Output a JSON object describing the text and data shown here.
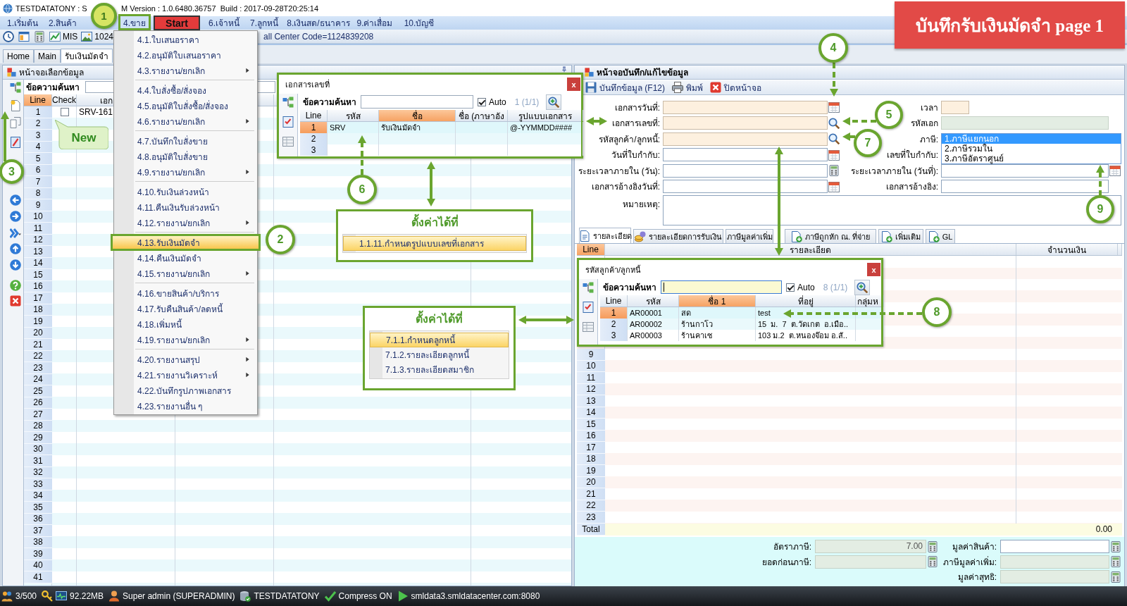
{
  "window": {
    "title_parts": [
      "TESTDATATONY : S",
      "M Version : 1.0.6480.36757  Build : 2017-09-28T20:25:14"
    ]
  },
  "menu_bar": [
    {
      "label": "1.เริ่มต้น",
      "selected": false
    },
    {
      "label": "2.สินค้า",
      "selected": false
    },
    {
      "label": "4.ขาย",
      "selected": true
    },
    {
      "label": "6.เจ้าหนี้",
      "selected": false
    },
    {
      "label": "7.ลูกหนี้",
      "selected": false
    },
    {
      "label": "8.เงินสด/ธนาคาร",
      "selected": false
    },
    {
      "label": "9.ค่าเสื่อม",
      "selected": false
    },
    {
      "label": "10.บัญชี",
      "selected": false
    }
  ],
  "start_badge": {
    "label": "Start"
  },
  "toolbar": {
    "items": [
      {
        "label": "MIS",
        "kind": "chart"
      },
      {
        "label": "1024",
        "kind": "picture"
      }
    ],
    "info": "all Center Code=1124839208"
  },
  "tabs": [
    {
      "label": "Home",
      "selected": false
    },
    {
      "label": "Main",
      "selected": false
    },
    {
      "label": "รับเงินมัดจำ",
      "selected": true
    }
  ],
  "sales_menu": {
    "sections": [
      {
        "items": [
          {
            "label": "4.1.ใบเสนอราคา",
            "submenu": false,
            "selected": false
          },
          {
            "label": "4.2.อนุมัติใบเสนอราคา",
            "submenu": false,
            "selected": false
          },
          {
            "label": "4.3.รายงาน/ยกเลิก",
            "submenu": true,
            "selected": false
          }
        ]
      },
      {
        "items": [
          {
            "label": "4.4.ใบสั่งซื้อ/สั่งจอง",
            "submenu": false,
            "selected": false
          },
          {
            "label": "4.5.อนุมัติใบสั่งซื้อ/สั่งจอง",
            "submenu": false,
            "selected": false
          },
          {
            "label": "4.6.รายงาน/ยกเลิก",
            "submenu": true,
            "selected": false
          }
        ]
      },
      {
        "items": [
          {
            "label": "4.7.บันทึกใบสั่งขาย",
            "submenu": false,
            "selected": false
          },
          {
            "label": "4.8.อนุมัติใบสั่งขาย",
            "submenu": false,
            "selected": false
          },
          {
            "label": "4.9.รายงาน/ยกเลิก",
            "submenu": true,
            "selected": false
          }
        ]
      },
      {
        "items": [
          {
            "label": "4.10.รับเงินล่วงหน้า",
            "submenu": false,
            "selected": false
          },
          {
            "label": "4.11.คืนเงินรับล่วงหน้า",
            "submenu": false,
            "selected": false
          },
          {
            "label": "4.12.รายงาน/ยกเลิก",
            "submenu": true,
            "selected": false
          }
        ]
      },
      {
        "items": [
          {
            "label": "4.13.รับเงินมัดจำ",
            "submenu": false,
            "selected": true
          },
          {
            "label": "4.14.คืนเงินมัดจำ",
            "submenu": false,
            "selected": false
          },
          {
            "label": "4.15.รายงาน/ยกเลิก",
            "submenu": true,
            "selected": false
          }
        ]
      },
      {
        "items": [
          {
            "label": "4.16.ขายสินค้า/บริการ",
            "submenu": false,
            "selected": false
          },
          {
            "label": "4.17.รับคืนสินค้า/ลดหนี้",
            "submenu": false,
            "selected": false
          },
          {
            "label": "4.18.เพิ่มหนี้",
            "submenu": false,
            "selected": false
          },
          {
            "label": "4.19.รายงาน/ยกเลิก",
            "submenu": true,
            "selected": false
          }
        ]
      },
      {
        "items": [
          {
            "label": "4.20.รายงานสรุป",
            "submenu": true,
            "selected": false
          },
          {
            "label": "4.21.รายงานวิเคราะห์",
            "submenu": true,
            "selected": false
          },
          {
            "label": "4.22.บันทึกรูปภาพเอกสาร",
            "submenu": false,
            "selected": false
          },
          {
            "label": "4.23.รายงานอื่น ๆ",
            "submenu": false,
            "selected": false
          }
        ]
      }
    ]
  },
  "selection_panel": {
    "title": "หน้าจอเลือกข้อมูล",
    "search_label": "ข้อความค้นหา",
    "columns": [
      {
        "label": "Line",
        "sorted": true
      },
      {
        "label": "Check",
        "sorted": false
      },
      {
        "label": "เอก",
        "sorted": false
      }
    ],
    "rows": [
      {
        "line": "1",
        "checked": false,
        "document": "SRV-161"
      },
      {
        "line": "2"
      },
      {
        "line": "3"
      },
      {
        "line": "4"
      },
      {
        "line": "5"
      },
      {
        "line": "6"
      },
      {
        "line": "7"
      },
      {
        "line": "8"
      },
      {
        "line": "9"
      },
      {
        "line": "10"
      },
      {
        "line": "11"
      },
      {
        "line": "12"
      },
      {
        "line": "13"
      },
      {
        "line": "14"
      },
      {
        "line": "15"
      },
      {
        "line": "16"
      },
      {
        "line": "17"
      },
      {
        "line": "18"
      },
      {
        "line": "19"
      },
      {
        "line": "20"
      },
      {
        "line": "21"
      },
      {
        "line": "22"
      },
      {
        "line": "23"
      },
      {
        "line": "24"
      },
      {
        "line": "25"
      },
      {
        "line": "26"
      },
      {
        "line": "27"
      },
      {
        "line": "28"
      },
      {
        "line": "29"
      },
      {
        "line": "30"
      },
      {
        "line": "31"
      },
      {
        "line": "32"
      },
      {
        "line": "33"
      },
      {
        "line": "34"
      },
      {
        "line": "35"
      },
      {
        "line": "36"
      },
      {
        "line": "37"
      },
      {
        "line": "38"
      },
      {
        "line": "39"
      },
      {
        "line": "40"
      },
      {
        "line": "41"
      }
    ]
  },
  "new_callout": {
    "label": "New"
  },
  "document_lookup": {
    "title": "เอกสารเลขที่",
    "close": "x",
    "search_label": "ข้อความค้นหา",
    "search_focused": false,
    "auto": {
      "label": "Auto",
      "checked": true
    },
    "count": "1 (1/1)",
    "columns": [
      {
        "label": "Line",
        "sorted": false
      },
      {
        "label": "รหัส",
        "sorted": false
      },
      {
        "label": "ชื่อ",
        "sorted": true
      },
      {
        "label": "ชื่อ (ภาษาอัง",
        "sorted": false
      },
      {
        "label": "รูปแบบเอกสาร",
        "sorted": false
      }
    ],
    "rows": [
      {
        "line": "1",
        "code": "SRV",
        "name": "รับเงินมัดจำ",
        "format": "@-YYMMDD####",
        "selected": true
      },
      {
        "line": "2",
        "selected": false
      },
      {
        "line": "3",
        "selected": false
      }
    ]
  },
  "settings_hints": [
    {
      "title": "ตั้งค่าได้ที่",
      "items": [
        {
          "label": "1.1.11.กำหนดรูปแบบเลขที่เอกสาร",
          "selected": true
        }
      ]
    },
    {
      "title": "ตั้งค่าได้ที่",
      "items": [
        {
          "label": "7.1.1.กำหนดลูกหนี้",
          "selected": true
        },
        {
          "label": "7.1.2.รายละเอียดลูกหนี้",
          "selected": false
        },
        {
          "label": "7.1.3.รายละเอียดสมาชิก",
          "selected": false
        }
      ]
    }
  ],
  "entry_panel": {
    "title": "หน้าจอบันทึก/แก้ไขข้อมูล",
    "toolbar": [
      {
        "label": "บันทึกข้อมูล (F12)",
        "kind": "save"
      },
      {
        "label": "พิมพ์",
        "kind": "print"
      },
      {
        "label": "ปิดหน้าจอ",
        "kind": "close"
      }
    ],
    "form": [
      {
        "left": {
          "label": "เอกสารวันที่:",
          "kind": "date",
          "required": true,
          "readonly": false
        },
        "right": {
          "label": "เวลา",
          "kind": "time",
          "required": true,
          "readonly": false
        }
      },
      {
        "left": {
          "label": "เอกสารเลขที่:",
          "kind": "lookup",
          "required": true,
          "readonly": false
        },
        "right": {
          "label": "รหัสเอก",
          "kind": "text",
          "required": false,
          "readonly": true
        }
      },
      {
        "left": {
          "label": "รหัสลูกค้า/ลูกหนี้:",
          "kind": "lookup",
          "required": true,
          "readonly": false
        },
        "right": {
          "label": "ภาษี:",
          "kind": "dropdown",
          "options": [
            {
              "label": "1.ภาษีแยกนอก",
              "selected": true
            },
            {
              "label": "2.ภาษีรวมใน",
              "selected": false
            },
            {
              "label": "3.ภาษีอัตราศูนย์",
              "selected": false
            }
          ]
        }
      },
      {
        "left": {
          "label": "วันที่ใบกำกับ:",
          "kind": "date",
          "required": false,
          "readonly": false
        },
        "right": {
          "label": "เลขที่ใบกำกับ:"
        }
      },
      {
        "left": {
          "label": "ระยะเวลาภายใน (วัน):",
          "kind": "number",
          "required": false,
          "readonly": false
        },
        "right": {
          "label": "ระยะเวลาภายใน (วันที่):",
          "kind": "date",
          "required": false,
          "readonly": false
        }
      },
      {
        "left": {
          "label": "เอกสารอ้างอิงวันที่:",
          "kind": "date",
          "required": false,
          "readonly": false
        },
        "right": {
          "label": "เอกสารอ้างอิง:",
          "kind": "text",
          "required": false,
          "readonly": false
        }
      },
      {
        "left": {
          "label": "หมายเหตุ:",
          "kind": "memo",
          "required": false,
          "readonly": false
        }
      }
    ],
    "detail_tabs": [
      {
        "label": "รายละเอียด",
        "kind": "document",
        "selected": true
      },
      {
        "label": "รายละเอียดการรับเงิน",
        "kind": "coins",
        "selected": false
      },
      {
        "label": "ภาษีมูลค่าเพิ่ม",
        "kind": "plain",
        "selected": false
      },
      {
        "label": "ภาษีถูกหัก ณ. ที่จ่าย",
        "kind": "add",
        "selected": false
      },
      {
        "label": "เพิ่มเติม",
        "kind": "add",
        "selected": false
      },
      {
        "label": "GL",
        "kind": "add",
        "selected": false
      }
    ],
    "detail_grid": {
      "columns": [
        {
          "label": "Line",
          "sorted": true
        },
        {
          "label": "รายละเอียด",
          "sorted": false
        },
        {
          "label": "จำนวนเงิน",
          "sorted": false
        }
      ],
      "lines": [
        "9",
        "10",
        "11",
        "12",
        "13",
        "14",
        "15",
        "16",
        "17",
        "18",
        "19",
        "20",
        "21",
        "22",
        "23"
      ],
      "total": {
        "label": "Total",
        "amount": "0.00"
      }
    },
    "summary": [
      {
        "left": {
          "label": "อัตราภาษี:",
          "value": "7.00",
          "readonly": true
        },
        "right": {
          "label": "มูลค่าสินค้า:",
          "readonly": false
        }
      },
      {
        "left": {
          "label": "ยอดก่อนภาษี:",
          "readonly": true
        },
        "right": {
          "label": "ภาษีมูลค่าเพิ่ม:",
          "readonly": true
        }
      },
      {
        "right": {
          "label": "มูลค่าสุทธิ:",
          "readonly": true
        }
      }
    ]
  },
  "customer_lookup": {
    "title": "รหัสลูกค้า/ลูกหนี้",
    "close": "x",
    "search_label": "ข้อความค้นหา",
    "search_focused": true,
    "auto": {
      "label": "Auto",
      "checked": true
    },
    "count": "8 (1/1)",
    "columns": [
      {
        "label": "Line",
        "sorted": false
      },
      {
        "label": "รหัส",
        "sorted": false
      },
      {
        "label": "ชื่อ 1",
        "sorted": true
      },
      {
        "label": "ที่อยู่",
        "sorted": false
      },
      {
        "label": "กลุ่มห",
        "sorted": false
      }
    ],
    "rows": [
      {
        "line": "1",
        "code": "AR00001",
        "name": "สด",
        "address": "test",
        "selected": true
      },
      {
        "line": "2",
        "code": "AR00002",
        "name": "ร้านกาโว",
        "address": "15  ม.  7  ต.วัดเกต  อ.เมือ..",
        "selected": false
      },
      {
        "line": "3",
        "code": "AR00003",
        "name": "ร้านคาเซ",
        "address": "103 ม.2  ต.หนองจ๊อม อ.สั..",
        "selected": false
      }
    ]
  },
  "step_markers": [
    {
      "label": "1",
      "filled": true
    },
    {
      "label": "2",
      "filled": false
    },
    {
      "label": "3",
      "filled": false
    },
    {
      "label": "4",
      "filled": false
    },
    {
      "label": "5",
      "filled": false
    },
    {
      "label": "6",
      "filled": false
    },
    {
      "label": "7",
      "filled": false
    },
    {
      "label": "8",
      "filled": false
    },
    {
      "label": "9",
      "filled": false
    }
  ],
  "banner": {
    "text": "บันทึกรับเงินมัดจำ page 1"
  },
  "status_bar": [
    {
      "text": "3/500",
      "kind": "users"
    },
    {
      "text": "92.22MB",
      "kind": "memory"
    },
    {
      "text": "Super admin (SUPERADMIN)",
      "kind": "user"
    },
    {
      "text": "TESTDATATONY",
      "kind": "database"
    },
    {
      "text": "Compress ON",
      "kind": "compress"
    },
    {
      "text": "smldata3.smldatacenter.com:8080",
      "kind": "server"
    }
  ]
}
